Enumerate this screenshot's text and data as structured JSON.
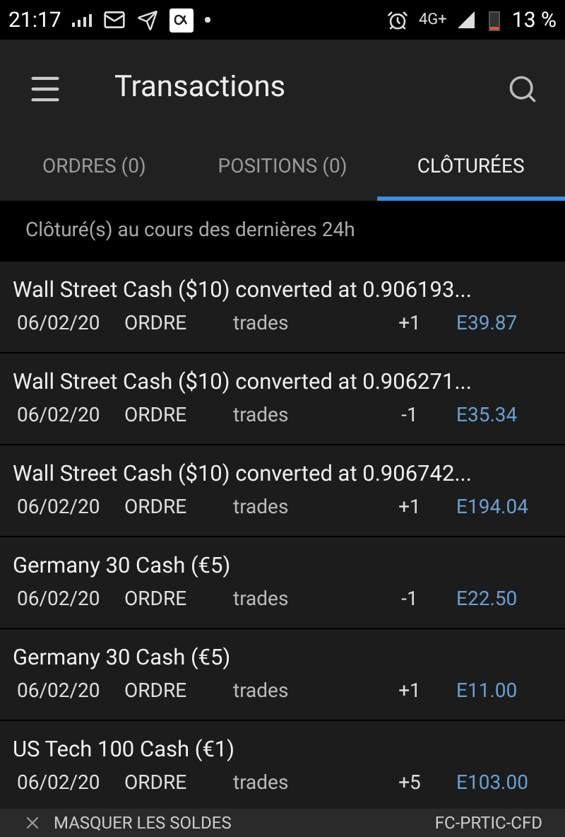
{
  "status_bar": {
    "time": "21:17",
    "battery": "13 %",
    "network": "4G+"
  },
  "app_bar": {
    "title": "Transactions"
  },
  "tabs": [
    {
      "label": "ORDRES (0)",
      "selected": false
    },
    {
      "label": "POSITIONS (0)",
      "selected": false
    },
    {
      "label": "CLÔTURÉES",
      "selected": true
    }
  ],
  "subheader": "Clôturé(s) au cours des dernières 24h",
  "transactions": [
    {
      "title": "Wall Street Cash ($10) converted at 0.906193...",
      "date": "06/02/20",
      "type": "ORDRE",
      "source": "trades",
      "quantity": "+1",
      "amount": "E39.87"
    },
    {
      "title": "Wall Street Cash ($10) converted at 0.906271...",
      "date": "06/02/20",
      "type": "ORDRE",
      "source": "trades",
      "quantity": "-1",
      "amount": "E35.34"
    },
    {
      "title": "Wall Street Cash ($10) converted at 0.906742...",
      "date": "06/02/20",
      "type": "ORDRE",
      "source": "trades",
      "quantity": "+1",
      "amount": "E194.04"
    },
    {
      "title": "Germany 30 Cash (€5)",
      "date": "06/02/20",
      "type": "ORDRE",
      "source": "trades",
      "quantity": "-1",
      "amount": "E22.50"
    },
    {
      "title": "Germany 30 Cash (€5)",
      "date": "06/02/20",
      "type": "ORDRE",
      "source": "trades",
      "quantity": "+1",
      "amount": "E11.00"
    },
    {
      "title": "US Tech 100 Cash (€1)",
      "date": "06/02/20",
      "type": "ORDRE",
      "source": "trades",
      "quantity": "+5",
      "amount": "E103.00"
    }
  ],
  "footer": {
    "toggle": "MASQUER LES SOLDES",
    "account": "FC-PRTIC-CFD"
  }
}
